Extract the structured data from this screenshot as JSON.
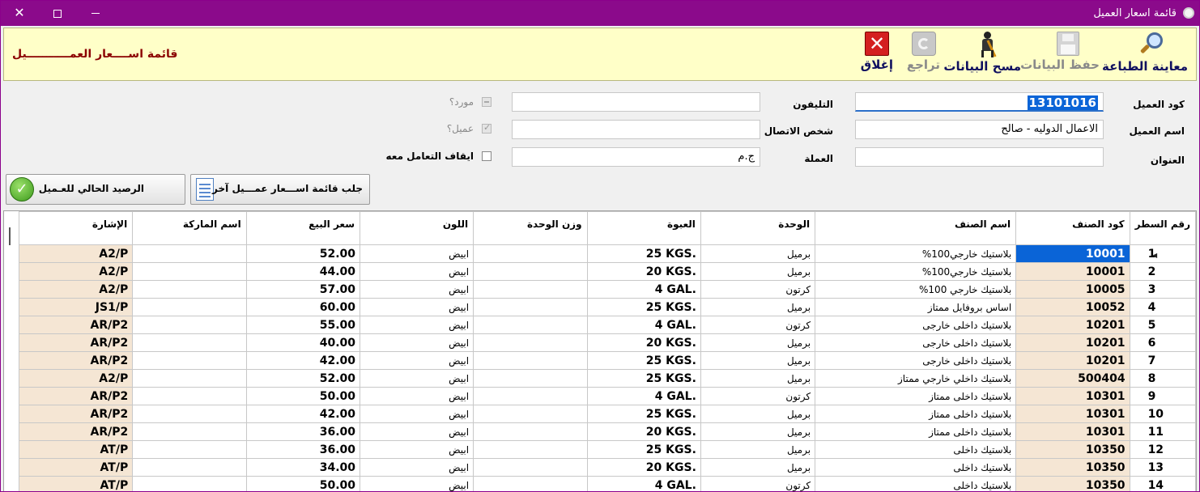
{
  "window": {
    "title": "قائمة اسعار العميل"
  },
  "toolbar": {
    "print_preview": "معاينة الطباعة",
    "save": "حفظ البيانات",
    "clear": "مسح البيانات",
    "undo": "تراجع",
    "close": "إغلاق",
    "form_title": "قائمة اســــعار العمـــــــــــيل"
  },
  "form": {
    "customer_code_label": "كود العميل",
    "customer_code_value": "13101016",
    "customer_name_label": "اسم العميل",
    "customer_name_value": "الاعمال الدوليه - صالح",
    "address_label": "العنوان",
    "address_value": "",
    "phone_label": "التليفون",
    "phone_value": "",
    "contact_label": "شخص الاتصال",
    "contact_value": "",
    "currency_label": "العملة",
    "currency_value": "ج.م",
    "supplier_label": "مورد؟",
    "is_customer_label": "عميل؟",
    "stop_dealing_label": "ايقاف التعامل معه"
  },
  "buttons": {
    "fetch_other": "جلب قائمة اســـعار عمـــيل آخر",
    "current_balance": "الرصيد الحالي للعـميل"
  },
  "grid": {
    "columns": {
      "line_no": "رقم السطر",
      "item_code": "كود الصنف",
      "item_name": "اسم  الصنف",
      "unit": "الوحدة",
      "pack": "العبوة",
      "unit_weight": "وزن الوحدة",
      "color": "اللون",
      "sale_price": "سعر البيع",
      "brand": "اسم الماركة",
      "symbol": "الإشارة"
    },
    "rows": [
      {
        "n": "1",
        "code": "10001",
        "name": "بلاستيك خارجي100%",
        "unit": "برميل",
        "pack": "25 KGS.",
        "weight": "",
        "color": "ابيض",
        "price": "52.00",
        "brand": "",
        "symbol": "A2/P"
      },
      {
        "n": "2",
        "code": "10001",
        "name": "بلاستيك خارجي100%",
        "unit": "برميل",
        "pack": "20 KGS.",
        "weight": "",
        "color": "ابيض",
        "price": "44.00",
        "brand": "",
        "symbol": "A2/P"
      },
      {
        "n": "3",
        "code": "10005",
        "name": "بلاستيك خارجي 100%",
        "unit": "كرتون",
        "pack": "4 GAL.",
        "weight": "",
        "color": "ابيض",
        "price": "57.00",
        "brand": "",
        "symbol": "A2/P"
      },
      {
        "n": "4",
        "code": "10052",
        "name": "اساس بروفايل ممتاز",
        "unit": "برميل",
        "pack": "25 KGS.",
        "weight": "",
        "color": "ابيض",
        "price": "60.00",
        "brand": "",
        "symbol": "JS1/P"
      },
      {
        "n": "5",
        "code": "10201",
        "name": "بلاستيك داخلى خارجى",
        "unit": "كرتون",
        "pack": "4 GAL.",
        "weight": "",
        "color": "ابيض",
        "price": "55.00",
        "brand": "",
        "symbol": "AR/P2"
      },
      {
        "n": "6",
        "code": "10201",
        "name": "بلاستيك داخلى خارجى",
        "unit": "برميل",
        "pack": "20 KGS.",
        "weight": "",
        "color": "ابيض",
        "price": "40.00",
        "brand": "",
        "symbol": "AR/P2"
      },
      {
        "n": "7",
        "code": "10201",
        "name": "بلاستيك داخلى خارجى",
        "unit": "برميل",
        "pack": "25 KGS.",
        "weight": "",
        "color": "ابيض",
        "price": "42.00",
        "brand": "",
        "symbol": "AR/P2"
      },
      {
        "n": "8",
        "code": "500404",
        "name": "بلاستيك داخلي خارجي ممتاز",
        "unit": "برميل",
        "pack": "25 KGS.",
        "weight": "",
        "color": "ابيض",
        "price": "52.00",
        "brand": "",
        "symbol": "A2/P"
      },
      {
        "n": "9",
        "code": "10301",
        "name": "بلاستيك داخلى ممتاز",
        "unit": "كرتون",
        "pack": "4 GAL.",
        "weight": "",
        "color": "ابيض",
        "price": "50.00",
        "brand": "",
        "symbol": "AR/P2"
      },
      {
        "n": "10",
        "code": "10301",
        "name": "بلاستيك داخلى ممتاز",
        "unit": "برميل",
        "pack": "25 KGS.",
        "weight": "",
        "color": "ابيض",
        "price": "42.00",
        "brand": "",
        "symbol": "AR/P2"
      },
      {
        "n": "11",
        "code": "10301",
        "name": "بلاستيك داخلى ممتاز",
        "unit": "برميل",
        "pack": "20 KGS.",
        "weight": "",
        "color": "ابيض",
        "price": "36.00",
        "brand": "",
        "symbol": "AR/P2"
      },
      {
        "n": "12",
        "code": "10350",
        "name": "بلاستيك داخلى",
        "unit": "برميل",
        "pack": "25 KGS.",
        "weight": "",
        "color": "ابيض",
        "price": "36.00",
        "brand": "",
        "symbol": "AT/P"
      },
      {
        "n": "13",
        "code": "10350",
        "name": "بلاستيك داخلى",
        "unit": "برميل",
        "pack": "20 KGS.",
        "weight": "",
        "color": "ابيض",
        "price": "34.00",
        "brand": "",
        "symbol": "AT/P"
      },
      {
        "n": "14",
        "code": "10350",
        "name": "بلاستيك داخلى",
        "unit": "كرتون",
        "pack": "4 GAL.",
        "weight": "",
        "color": "ابيض",
        "price": "50.00",
        "brand": "",
        "symbol": "AT/P"
      }
    ]
  },
  "colors": {
    "titlebar": "#8b0a8b",
    "toolbar_bg": "#ffffc8",
    "selection": "#0a64d7",
    "code_cell_bg": "#f5e6d4"
  }
}
